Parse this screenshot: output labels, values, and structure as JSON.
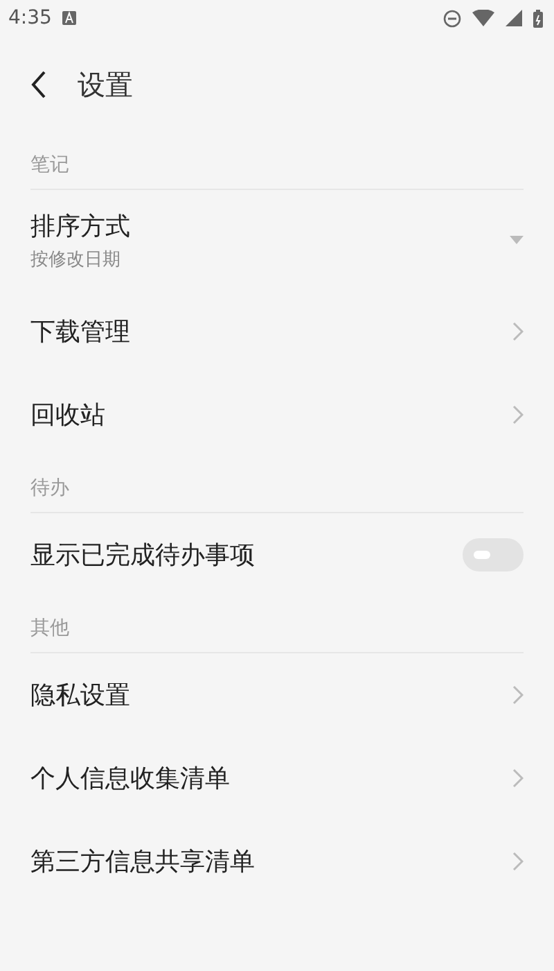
{
  "status_bar": {
    "time": "4:35"
  },
  "header": {
    "title": "设置"
  },
  "sections": [
    {
      "title": "笔记",
      "items": [
        {
          "kind": "dropdown",
          "label": "排序方式",
          "value": "按修改日期"
        },
        {
          "kind": "link",
          "label": "下载管理"
        },
        {
          "kind": "link",
          "label": "回收站"
        }
      ]
    },
    {
      "title": "待办",
      "items": [
        {
          "kind": "toggle",
          "label": "显示已完成待办事项",
          "on": false
        }
      ]
    },
    {
      "title": "其他",
      "items": [
        {
          "kind": "link",
          "label": "隐私设置"
        },
        {
          "kind": "link",
          "label": "个人信息收集清单"
        },
        {
          "kind": "link",
          "label": "第三方信息共享清单"
        }
      ]
    }
  ]
}
